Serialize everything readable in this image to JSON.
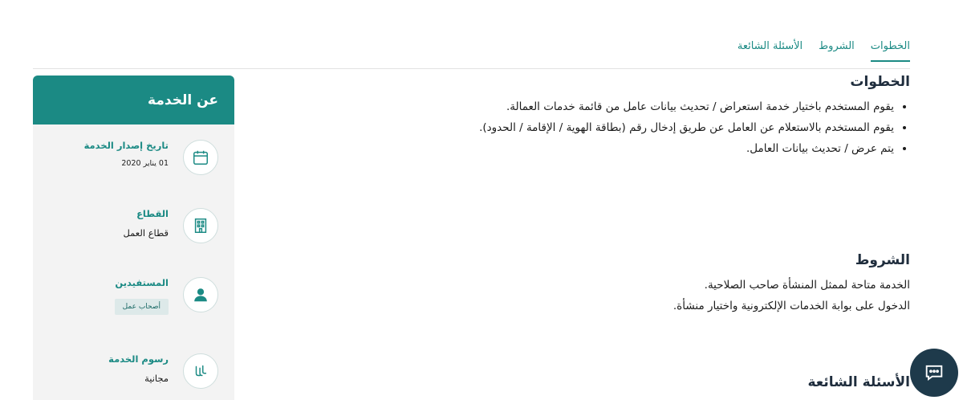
{
  "tabs": [
    {
      "label": "الخطوات",
      "active": true
    },
    {
      "label": "الشروط",
      "active": false
    },
    {
      "label": "الأسئلة الشائعة",
      "active": false
    }
  ],
  "steps": {
    "title": "الخطوات",
    "items": [
      "يقوم المستخدم باختيار خدمة استعراض / تحديث بيانات عامل من قائمة خدمات العمالة.",
      "يقوم المستخدم بالاستعلام عن العامل عن طريق إدخال رقم (بطاقة الهوية / الإقامة / الحدود).",
      "يتم عرض / تحديث بيانات العامل."
    ]
  },
  "conditions": {
    "title": "الشروط",
    "lines": [
      "الخدمة متاحة لممثل المنشأة صاحب الصلاحية.",
      "الدخول على بوابة الخدمات الإلكترونية واختيار منشأة."
    ]
  },
  "faq": {
    "title": "الأسئلة الشائعة"
  },
  "about": {
    "title": "عن الخدمة",
    "release_date": {
      "label": "تاريخ إصدار الخدمة",
      "value": "01 يناير 2020",
      "icon": "calendar-icon"
    },
    "sector": {
      "label": "القطاع",
      "value": "قطاع العمل",
      "icon": "building-icon"
    },
    "beneficiaries": {
      "label": "المستفيدين",
      "value": "أصحاب عمل",
      "icon": "user-icon"
    },
    "fees": {
      "label": "رسوم الخدمة",
      "value": "مجانية",
      "icon": "riyal-icon"
    }
  },
  "chat": {
    "icon": "chat-icon"
  },
  "colors": {
    "accent": "#1b8a84",
    "card_bg": "#f3f3f3",
    "chat_bg": "#1e3a4b"
  }
}
